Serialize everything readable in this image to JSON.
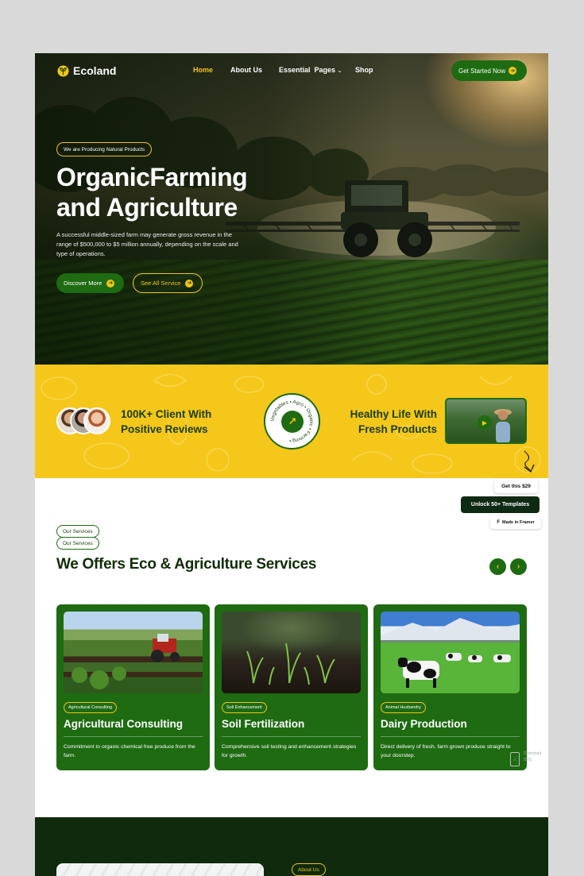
{
  "brand": {
    "name": "Ecoland",
    "accent_green": "#1e6b12",
    "accent_yellow": "#f5c71a",
    "dark_green": "#0f2a0c"
  },
  "nav": {
    "home": "Home",
    "about": "About Us",
    "pages": "Essential  Pages",
    "pages_caret": "⌄",
    "shop": "Shop",
    "cta": "Get Started Now",
    "cta_icon": "➜"
  },
  "hero": {
    "tag": "We are Producing Natural Products",
    "title": "OrganicFarming and Agriculture",
    "text": "A successful middle-sized farm may generate gross revenue in the range of $500,000 to $5 million annually, depending on the scale and type of operations.",
    "btn_primary": "Discover More",
    "btn_secondary": "See All Service",
    "btn_icon": "➜"
  },
  "band": {
    "left_text": "100K+ Client With Positive Reviews",
    "badge_ring": "Vegetables • Agro • Organic • Farming •",
    "badge_icon": "↗",
    "right_text": "Healthy Life With Fresh Products",
    "play_icon": "▶"
  },
  "floating": {
    "price": "Get this $29",
    "unlock": "Unlock 50+ Templates",
    "framer": "Made in Framer",
    "framer_icon": "F"
  },
  "services": {
    "pill1": "Our Services",
    "pill2": "Our Services",
    "title": "We Offers Eco & Agriculture Services",
    "prev_icon": "‹",
    "next_icon": "›",
    "cards": [
      {
        "tag": "Agricultural Consulting",
        "title": "Agricultural Consulting",
        "text": "Commitment to organic chemical free produce from the farm."
      },
      {
        "tag": "Soil Enhancement",
        "title": "Soil Fertilization",
        "text": "Comprehensive soil testing and enhancement strategies for growth."
      },
      {
        "tag": "Animal Husbandry",
        "title": "Dairy Production",
        "text": "Direct delivery of fresh, farm grown produce straight to your doorstep."
      }
    ]
  },
  "download": {
    "line1": "Download",
    "line2": "SVG",
    "icon": "⤓"
  },
  "about": {
    "pill": "About Us"
  }
}
